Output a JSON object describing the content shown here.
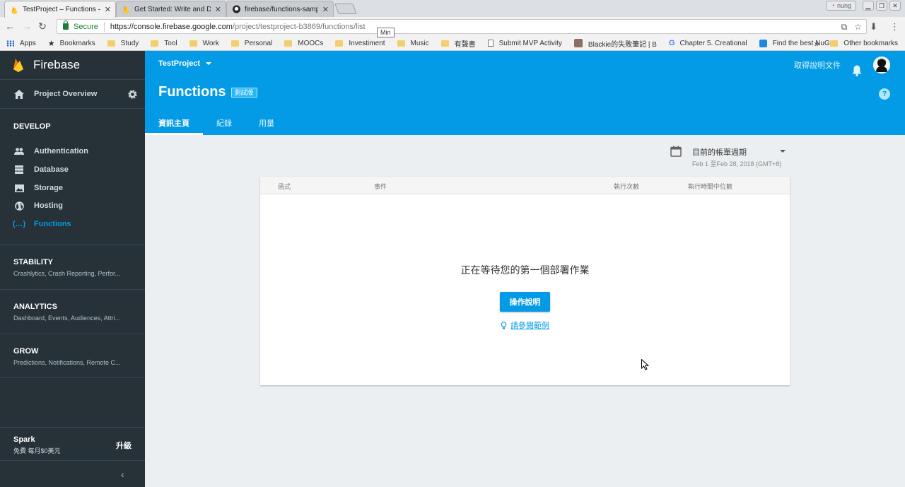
{
  "browser": {
    "tabs": [
      {
        "title": "TestProject – Functions –",
        "icon": "firebase-icon"
      },
      {
        "title": "Get Started: Write and D",
        "icon": "firebase-icon"
      },
      {
        "title": "firebase/functions-sampl",
        "icon": "github-icon"
      }
    ],
    "profile_label": "nung",
    "secure_label": "Secure",
    "url_host": "https://console.firebase.google.com",
    "url_path": "/project/testproject-b3869/functions/list",
    "tooltip": "Min",
    "bookmarks": [
      {
        "label": "Apps",
        "icon": "grid"
      },
      {
        "label": "Bookmarks",
        "icon": "star"
      },
      {
        "label": "Study",
        "icon": "folder"
      },
      {
        "label": "Tool",
        "icon": "folder"
      },
      {
        "label": "Work",
        "icon": "folder"
      },
      {
        "label": "Personal",
        "icon": "folder"
      },
      {
        "label": "MOOCs",
        "icon": "folder"
      },
      {
        "label": "Investiment",
        "icon": "folder"
      },
      {
        "label": "Music",
        "icon": "folder"
      },
      {
        "label": "有聲書",
        "icon": "folder"
      },
      {
        "label": "Submit MVP Activity",
        "icon": "doc"
      },
      {
        "label": "Blackie的失敗筆記 | B",
        "icon": "avatar"
      },
      {
        "label": "Chapter 5. Creational",
        "icon": "google"
      },
      {
        "label": "Find the best NuGet",
        "icon": "nuget"
      }
    ],
    "bookmarks_overflow": "»",
    "other_bookmarks": "Other bookmarks"
  },
  "sidebar": {
    "brand": "Firebase",
    "overview": "Project Overview",
    "develop_title": "DEVELOP",
    "develop_items": [
      {
        "label": "Authentication",
        "icon": "people-icon"
      },
      {
        "label": "Database",
        "icon": "database-icon"
      },
      {
        "label": "Storage",
        "icon": "image-icon"
      },
      {
        "label": "Hosting",
        "icon": "globe-icon"
      },
      {
        "label": "Functions",
        "icon": "functions-icon",
        "active": true
      }
    ],
    "groups": [
      {
        "title": "STABILITY",
        "sub": "Crashlytics, Crash Reporting, Perfor..."
      },
      {
        "title": "ANALYTICS",
        "sub": "Dashboard, Events, Audiences, Attri..."
      },
      {
        "title": "GROW",
        "sub": "Predictions, Notifications, Remote C..."
      }
    ],
    "plan": {
      "name": "Spark",
      "sub": "免費 每月$0美元",
      "upgrade": "升級"
    },
    "collapse": "‹"
  },
  "header": {
    "project": "TestProject",
    "title": "Functions",
    "beta": "測試版",
    "docs": "取得說明文件",
    "help": "?",
    "tabs": [
      "資訊主頁",
      "紀錄",
      "用量"
    ]
  },
  "main": {
    "period_label": "目前的帳單週期",
    "period_range": "Feb 1 至Feb 28, 2018 (GMT+8)",
    "columns": [
      "函式",
      "事件",
      "執行次數",
      "執行時間中位數"
    ],
    "empty_title": "正在等待您的第一個部署作業",
    "howto_button": "操作說明",
    "samples_link": "請參閱範例"
  },
  "colors": {
    "accent": "#039be5",
    "sidebar": "#263238",
    "background": "#eceff1"
  }
}
